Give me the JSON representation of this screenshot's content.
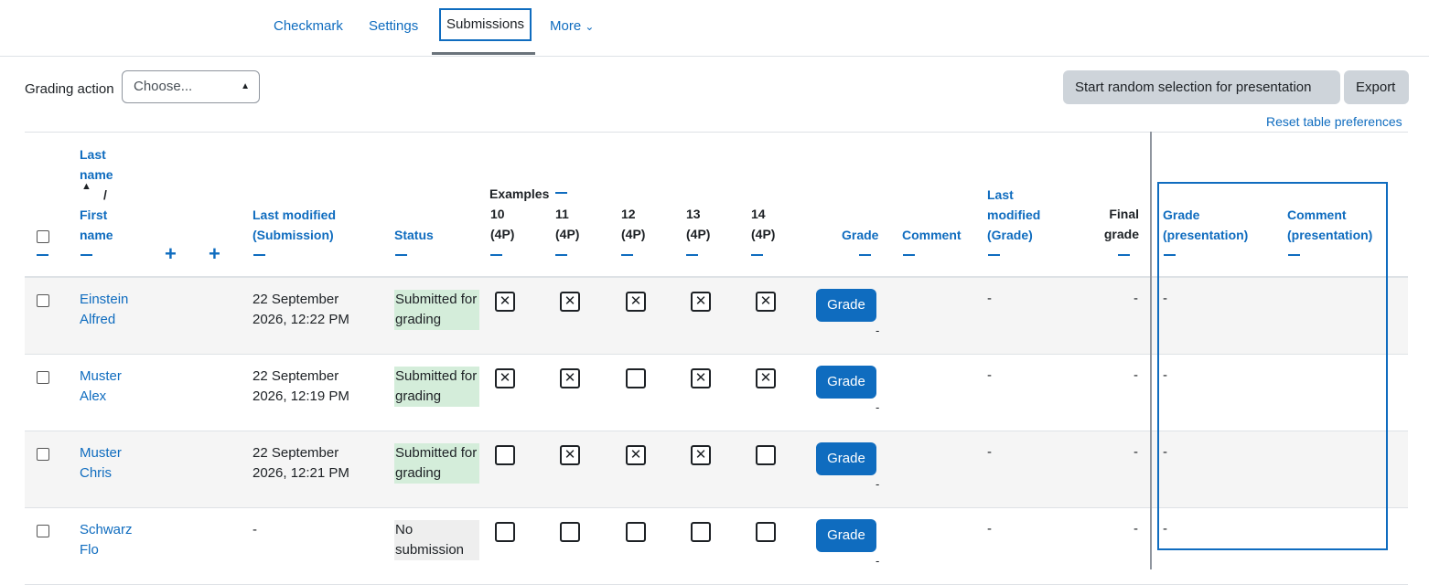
{
  "tabs": {
    "checkmark": "Checkmark",
    "settings": "Settings",
    "submissions": "Submissions",
    "more": "More",
    "more_chevron": "⌄"
  },
  "toolbar": {
    "grading_action_label": "Grading action",
    "grading_action_value": "Choose...",
    "random_selection_button": "Start random selection for presentation",
    "export_button": "Export",
    "reset_link": "Reset table preferences"
  },
  "table": {
    "headers": {
      "last_name": [
        "Last",
        "name"
      ],
      "sort_arrow": "▲",
      "slash": "/",
      "first_name": [
        "First",
        "name"
      ],
      "plus": "+",
      "last_modified_submission": [
        "Last modified",
        "(Submission)"
      ],
      "status": "Status",
      "examples": "Examples",
      "example_cols": [
        {
          "num": "10",
          "pts": "(4P)"
        },
        {
          "num": "11",
          "pts": "(4P)"
        },
        {
          "num": "12",
          "pts": "(4P)"
        },
        {
          "num": "13",
          "pts": "(4P)"
        },
        {
          "num": "14",
          "pts": "(4P)"
        }
      ],
      "grade": "Grade",
      "comment": "Comment",
      "last_modified_grade": [
        "Last",
        "modified",
        "(Grade)"
      ],
      "final_grade": [
        "Final",
        "grade"
      ],
      "grade_presentation": [
        "Grade",
        "(presentation)"
      ],
      "comment_presentation": [
        "Comment",
        "(presentation)"
      ]
    },
    "grade_button_label": "Grade",
    "rows": [
      {
        "last": "Einstein",
        "first": "Alfred",
        "date1": "22 September",
        "date2": "2026, 12:22 PM",
        "status1": "Submitted for",
        "status2": "grading",
        "status_type": "sub",
        "checks": [
          true,
          true,
          true,
          true,
          true
        ],
        "grade_dash": "-",
        "lm_grade": "-",
        "final": "-",
        "grade_pres": "-"
      },
      {
        "last": "Muster",
        "first": "Alex",
        "date1": "22 September",
        "date2": "2026, 12:19 PM",
        "status1": "Submitted for",
        "status2": "grading",
        "status_type": "sub",
        "checks": [
          true,
          true,
          false,
          true,
          true
        ],
        "grade_dash": "-",
        "lm_grade": "-",
        "final": "-",
        "grade_pres": "-"
      },
      {
        "last": "Muster",
        "first": "Chris",
        "date1": "22 September",
        "date2": "2026, 12:21 PM",
        "status1": "Submitted for",
        "status2": "grading",
        "status_type": "sub",
        "checks": [
          false,
          true,
          true,
          true,
          false
        ],
        "grade_dash": "-",
        "lm_grade": "-",
        "final": "-",
        "grade_pres": "-"
      },
      {
        "last": "Schwarz",
        "first": "Flo",
        "date1": "-",
        "date2": "",
        "status1": "No",
        "status2": "submission",
        "status_type": "no",
        "checks": [
          false,
          false,
          false,
          false,
          false
        ],
        "grade_dash": "-",
        "lm_grade": "-",
        "final": "-",
        "grade_pres": "-"
      }
    ]
  },
  "colors": {
    "link": "#0f6cbf",
    "submitted_bg": "#d4edda",
    "no_submission_bg": "#eeeeee",
    "button_grey": "#ced4da",
    "row_stripe": "#f5f5f5"
  }
}
